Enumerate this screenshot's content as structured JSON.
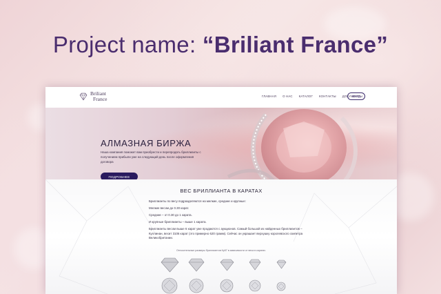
{
  "headline": {
    "project_label": "Project name: ",
    "project_name": "“Briliant France”"
  },
  "site": {
    "logo_line1": "Briliant",
    "logo_line2": "France",
    "menu": [
      "ГЛАВНАЯ",
      "О НАС",
      "КАТАЛОГ",
      "КОНТАКТЫ",
      "ДОКУМЕНТЫ"
    ],
    "login_label": "ВХОД"
  },
  "hero": {
    "title": "АЛМАЗНАЯ БИРЖА",
    "text": "Наша компания поможет вам приобрести и перепродать бриллианты с получением прибыли уже на следующий день после оформления договора",
    "button_label": "ПОДРОБНЕЕ"
  },
  "content": {
    "title": "ВЕС БРИЛЛИАНТА В КАРАТАХ",
    "paragraphs": [
      "Бриллианты по весу подразделяются на мелкие, средние и крупные:",
      "Мелкие весом до 0.30 карат.",
      "Средние – от 0.30 до 1 карата.",
      "И крупные бриллианты – выше 1 карата.",
      "Бриллианты весом выше 6 карат уже продаются с аукционов. Самый большой из найденных бриллиантов – Куллинан, весит 3106 карат (это примерно 620 грамм). Сейчас он украшает верхушку королевского скипетра Великобритании."
    ],
    "caption": "Относительные размеры бриллиантов Кр57 в зависимости от веса в каратах."
  },
  "colors": {
    "brand": "#3b2a6b",
    "headline": "#4a2d6e",
    "button": "#2a1a5e"
  }
}
